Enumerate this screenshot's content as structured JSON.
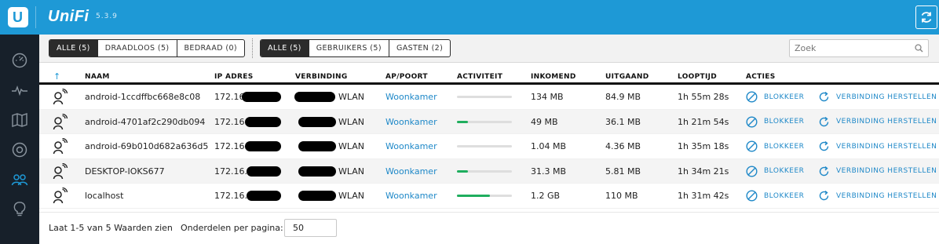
{
  "app": {
    "brand": "UniFi",
    "version": "5.3.9"
  },
  "filters": {
    "group1": [
      "ALLE (5)",
      "DRAADLOOS (5)",
      "BEDRAAD (0)"
    ],
    "group2": [
      "ALLE (5)",
      "GEBRUIKERS (5)",
      "GASTEN (2)"
    ]
  },
  "search": {
    "placeholder": "Zoek"
  },
  "table": {
    "headers": [
      "NAAM",
      "IP ADRES",
      "VERBINDING",
      "AP/POORT",
      "ACTIVITEIT",
      "INKOMEND",
      "UITGAAND",
      "LOOPTIJD",
      "ACTIES"
    ],
    "rows": [
      {
        "name": "android-1ccdffbc668e8c08",
        "ip": "172.16",
        "conn": "WLAN",
        "ap": "Woonkamer",
        "activity": 0,
        "in": "134 MB",
        "out": "84.9 MB",
        "uptime": "1h 55m 28s"
      },
      {
        "name": "android-4701af2c290db094",
        "ip": "172.16.",
        "conn": "WLAN",
        "ap": "Woonkamer",
        "activity": 0.2,
        "in": "49 MB",
        "out": "36.1 MB",
        "uptime": "1h 21m 54s"
      },
      {
        "name": "android-69b010d682a636d5",
        "ip": "172.16.",
        "conn": "WLAN",
        "ap": "Woonkamer",
        "activity": 0,
        "in": "1.04 MB",
        "out": "4.36 MB",
        "uptime": "1h 35m 18s"
      },
      {
        "name": "DESKTOP-IOKS677",
        "ip": "172.16.1",
        "conn": "WLAN",
        "ap": "Woonkamer",
        "activity": 0.2,
        "in": "31.3 MB",
        "out": "5.81 MB",
        "uptime": "1h 34m 21s"
      },
      {
        "name": "localhost",
        "ip": "172.16.1",
        "conn": "WLAN",
        "ap": "Woonkamer",
        "activity": 0.6,
        "in": "1.2 GB",
        "out": "110 MB",
        "uptime": "1h 31m 42s"
      }
    ],
    "action_block": "BLOKKEER",
    "action_reconnect": "VERBINDING HERSTELLEN"
  },
  "footer": {
    "summary": "Laat 1-5 van 5 Waarden zien",
    "per_page_label": "Onderdelen per pagina:",
    "per_page_value": "50"
  },
  "colors": {
    "accent": "#1e99d6",
    "sidebar": "#17202a",
    "activity": "#1fae5e"
  },
  "icons": [
    "unifi-logo-icon",
    "refresh-icon",
    "dashboard-icon",
    "statistics-icon",
    "map-icon",
    "devices-icon",
    "clients-icon",
    "insights-icon",
    "search-icon",
    "wireless-client-icon",
    "block-icon",
    "reconnect-icon"
  ]
}
